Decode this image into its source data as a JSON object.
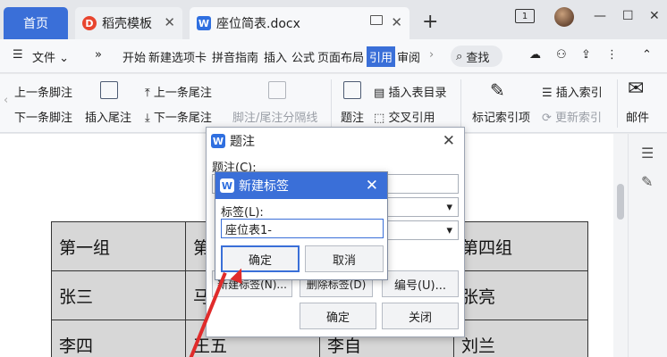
{
  "tabs": {
    "home": "首页",
    "template": "稻壳模板",
    "document": "座位简表.docx",
    "template_logo": "D",
    "doc_logo": "W"
  },
  "window": {
    "badge": "1",
    "minimize": "—",
    "restore": "☐",
    "close": "✕"
  },
  "menubar": {
    "file": "文件",
    "items": [
      "开始",
      "新建选项卡",
      "拼音指南",
      "插入",
      "公式",
      "页面布局",
      "引用",
      "审阅"
    ],
    "active": "引用",
    "search": "查找"
  },
  "ribbon": {
    "prev_footnote": "上一条脚注",
    "next_footnote": "下一条脚注",
    "insert_endnote": "插入尾注",
    "prev_endnote": "上一条尾注",
    "next_endnote": "下一条尾注",
    "foot_end_separator": "脚注/尾注分隔线",
    "caption": "题注",
    "insert_toc": "插入表目录",
    "cross_ref": "交叉引用",
    "mark_index": "标记索引项",
    "insert_index": "插入索引",
    "update_index": "更新索引",
    "mail": "邮件"
  },
  "document_table": {
    "rows": [
      [
        "第一组",
        "第",
        "",
        "第四组"
      ],
      [
        "张三",
        "马",
        "",
        "张亮"
      ],
      [
        "李四",
        "王五",
        "李自",
        "刘兰"
      ]
    ]
  },
  "caption_dialog": {
    "title": "题注",
    "caption_label": "题注(C):",
    "new_label_button": "新建标签(N)...",
    "delete_label_button": "删除标签(D)",
    "numbering_button": "编号(U)...",
    "ok": "确定",
    "close": "关闭"
  },
  "new_label_dialog": {
    "title": "新建标签",
    "label_caption": "标签(L):",
    "label_value": "座位表1-",
    "ok": "确定",
    "cancel": "取消"
  }
}
